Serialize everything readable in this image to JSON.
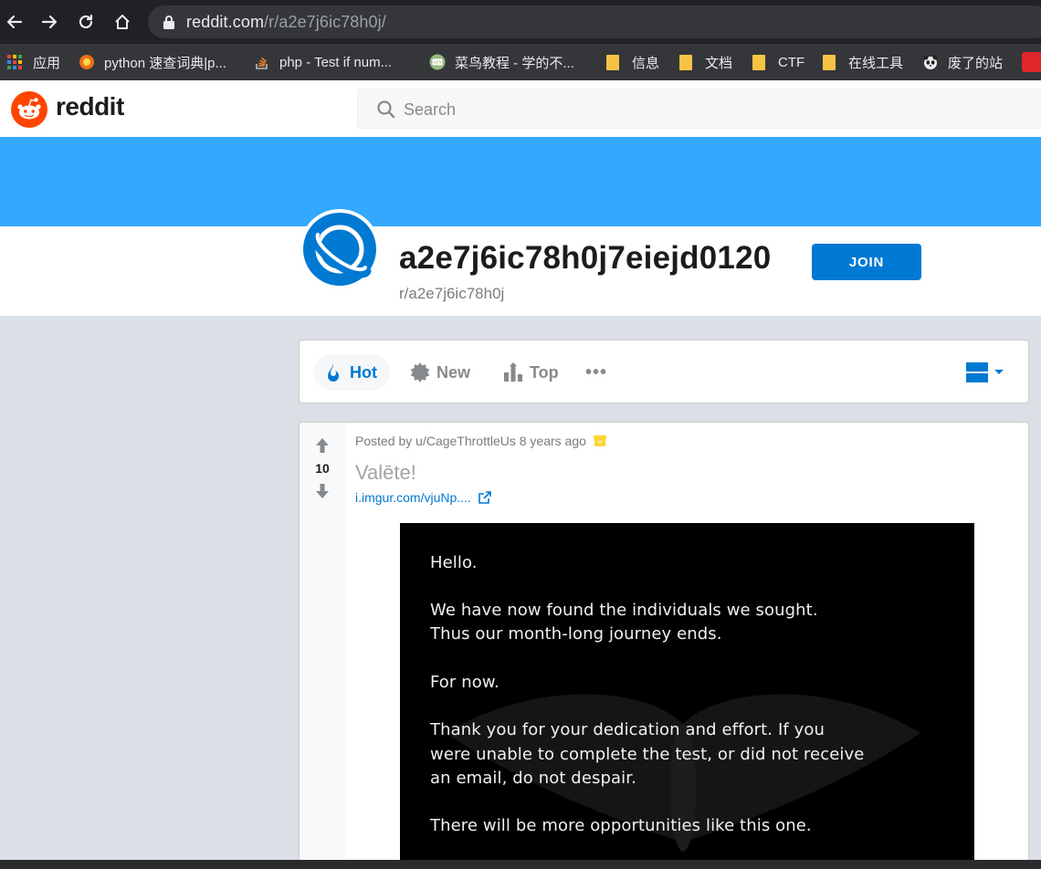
{
  "browser": {
    "url_host": "reddit.com",
    "url_path": "/r/a2e7j6ic78h0j/",
    "bookmarks": [
      {
        "label": "应用",
        "icon": "apps-grid-icon"
      },
      {
        "label": "python 速查词典|p...",
        "icon": "python-site-icon"
      },
      {
        "label": "php - Test if num...",
        "icon": "stackoverflow-icon"
      },
      {
        "label": "菜鸟教程 - 学的不...",
        "icon": "runoob-icon"
      },
      {
        "label": "信息",
        "icon": "folder-icon"
      },
      {
        "label": "文档",
        "icon": "folder-icon"
      },
      {
        "label": "CTF",
        "icon": "folder-icon"
      },
      {
        "label": "在线工具",
        "icon": "folder-icon"
      },
      {
        "label": "废了的站",
        "icon": "panda-icon"
      }
    ]
  },
  "header": {
    "logo_text": "reddit",
    "search_placeholder": "Search"
  },
  "subreddit": {
    "title": "a2e7j6ic78h0j7eiejd0120",
    "name": "r/a2e7j6ic78h0j",
    "join_label": "JOIN"
  },
  "sort": {
    "hot": "Hot",
    "new": "New",
    "top": "Top",
    "more": "•••"
  },
  "post": {
    "score": "10",
    "meta": "Posted by u/CageThrottleUs 8 years ago",
    "title": "Valēte!",
    "link": "i.imgur.com/vjuNp....",
    "image_text": [
      "Hello.",
      "We have now found the individuals we sought.",
      "Thus our month-long journey ends.",
      "For now.",
      "Thank you for your dedication and effort.  If you",
      "were unable to complete the test, or did not receive",
      "an email, do not despair.",
      "There will be more opportunities like this one."
    ]
  },
  "colors": {
    "banner": "#33a8ff",
    "accent": "#0079d3",
    "reddit_orange": "#ff4500"
  }
}
